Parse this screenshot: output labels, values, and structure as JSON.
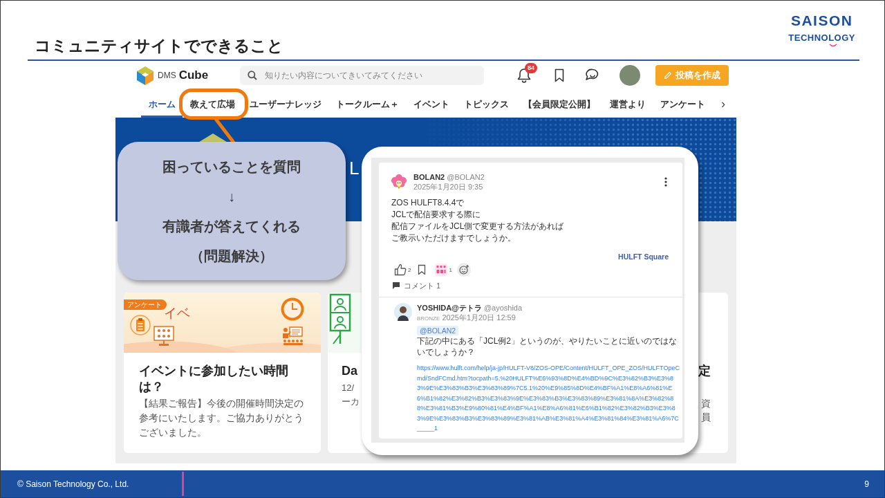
{
  "slide": {
    "title": "コミュニティサイトでできること",
    "logo": {
      "line_1": "SAISON",
      "line_2": "TECHNOLOGY"
    }
  },
  "site_header": {
    "brand": {
      "prefix": "DMS",
      "name": "Cube"
    },
    "search": {
      "placeholder": "知りたい内容についてきいてみてください"
    },
    "notification_badge": "84",
    "post_button": "投稿を作成"
  },
  "nav": {
    "tabs": [
      {
        "label": "ホーム",
        "selected": true,
        "highlighted": false
      },
      {
        "label": "教えて広場",
        "selected": false,
        "highlighted": true
      },
      {
        "label": "ユーザーナレッジ",
        "selected": false,
        "highlighted": false
      },
      {
        "label": "トークルーム＋",
        "selected": false,
        "highlighted": false
      },
      {
        "label": "イベント",
        "selected": false,
        "highlighted": false
      },
      {
        "label": "トピックス",
        "selected": false,
        "highlighted": false
      },
      {
        "label": "【会員限定公開】",
        "selected": false,
        "highlighted": false
      },
      {
        "label": "運営より",
        "selected": false,
        "highlighted": false
      },
      {
        "label": "アンケート",
        "selected": false,
        "highlighted": false
      }
    ],
    "more": "›"
  },
  "hero": {
    "title_fragment": "L"
  },
  "callout": {
    "lines": [
      "困っていることを質問",
      "↓",
      "有識者が答えてくれる",
      "（問題解決）"
    ]
  },
  "cards": [
    {
      "kind": "full",
      "badge": "アンケート",
      "banner_text": "イベ",
      "title": "イベントに参加したい時間は？",
      "description": "【結果ご報告】今後の開催時間決定の参考にいたします。ご協力ありがとうございました。"
    },
    {
      "kind": "left_visible",
      "title": "Da",
      "lines": [
        "12/",
        "ーカ"
      ]
    },
    {
      "kind": "right_visible",
      "title": "定",
      "lines": [
        "資",
        "員"
      ]
    }
  ],
  "post": {
    "author": "BOLAN2",
    "handle": "@BOLAN2",
    "date": "2025年1月20日 9:35",
    "body": [
      "ZOS HULFT8.4.4で",
      "JCLで配信要求する際に",
      "配信ファイルをJCL側で変更する方法があれば",
      "ご教示いただけますでしょうか。"
    ],
    "source": "HULFT Square",
    "likes": "2",
    "sticker_count": "1",
    "comments": "コメント 1"
  },
  "comment": {
    "author": "YOSHIDA@テトラ",
    "handle": "@ayoshida",
    "rank": "BRONZE",
    "date": "2025年1月20日 12:59",
    "mention": "@BOLAN2",
    "text": "下記の中にある「JCL例2」というのが、やりたいことに近いのではないでしょうか？",
    "link": "https://www.hulft.com/help/ja-jp/HULFT-V8/ZOS-OPE/Content/HULFT_OPE_ZOS/HULFTOpeCmd/SndFCmd.htm?tocpath=5.%20HULFT%E6%93%8D%E4%BD%9C%E3%82%B3%E3%83%9E%E3%83%B3%E3%83%89%7C5.1%20%E9%85%8D%E4%BF%A1%E8%A6%81%E6%B1%82%E3%82%B3%E3%83%9E%E3%83%B3%E3%83%89%E3%81%8A%E3%82%88%E3%81%B3%E9%80%81%E4%BF%A1%E8%A6%81%E6%B1%82%E3%82%B3%E3%83%9E%E3%83%B3%E3%83%89%E3%81%AB%E3%81%A4%E3%81%84%E3%81%A6%7C_____1"
  },
  "footer": {
    "copyright": "© Saison Technology Co., Ltd.",
    "page": "9"
  }
}
